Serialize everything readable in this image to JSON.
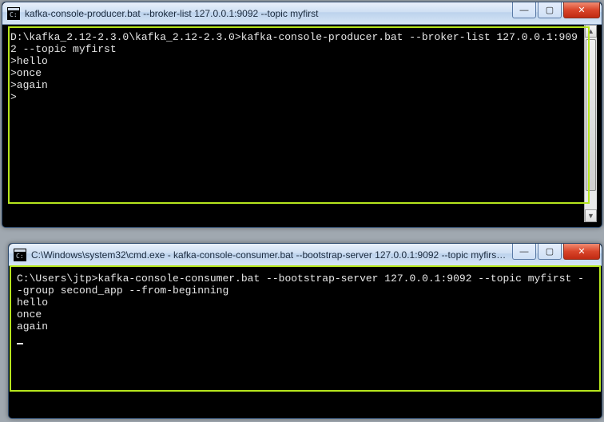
{
  "window1": {
    "title": "kafka-console-producer.bat  --broker-list 127.0.0.1:9092 --topic myfirst",
    "terminal": {
      "line1": "D:\\kafka_2.12-2.3.0\\kafka_2.12-2.3.0>kafka-console-producer.bat --broker-list 127.0.0.1:909",
      "line2": "2 --topic myfirst",
      "line3": ">hello",
      "line4": ">once",
      "line5": ">again",
      "line6": ">"
    },
    "buttons": {
      "min": "—",
      "max": "▢",
      "close": "✕"
    }
  },
  "window2": {
    "title": "C:\\Windows\\system32\\cmd.exe - kafka-console-consumer.bat  --bootstrap-server 127.0.0.1:9092 --topic myfirst --...",
    "terminal": {
      "line1": "C:\\Users\\jtp>kafka-console-consumer.bat --bootstrap-server 127.0.0.1:9092 --topic myfirst -",
      "line2": "-group second_app --from-beginning",
      "line3": "hello",
      "line4": "once",
      "line5": "again"
    },
    "buttons": {
      "min": "—",
      "max": "▢",
      "close": "✕"
    }
  }
}
